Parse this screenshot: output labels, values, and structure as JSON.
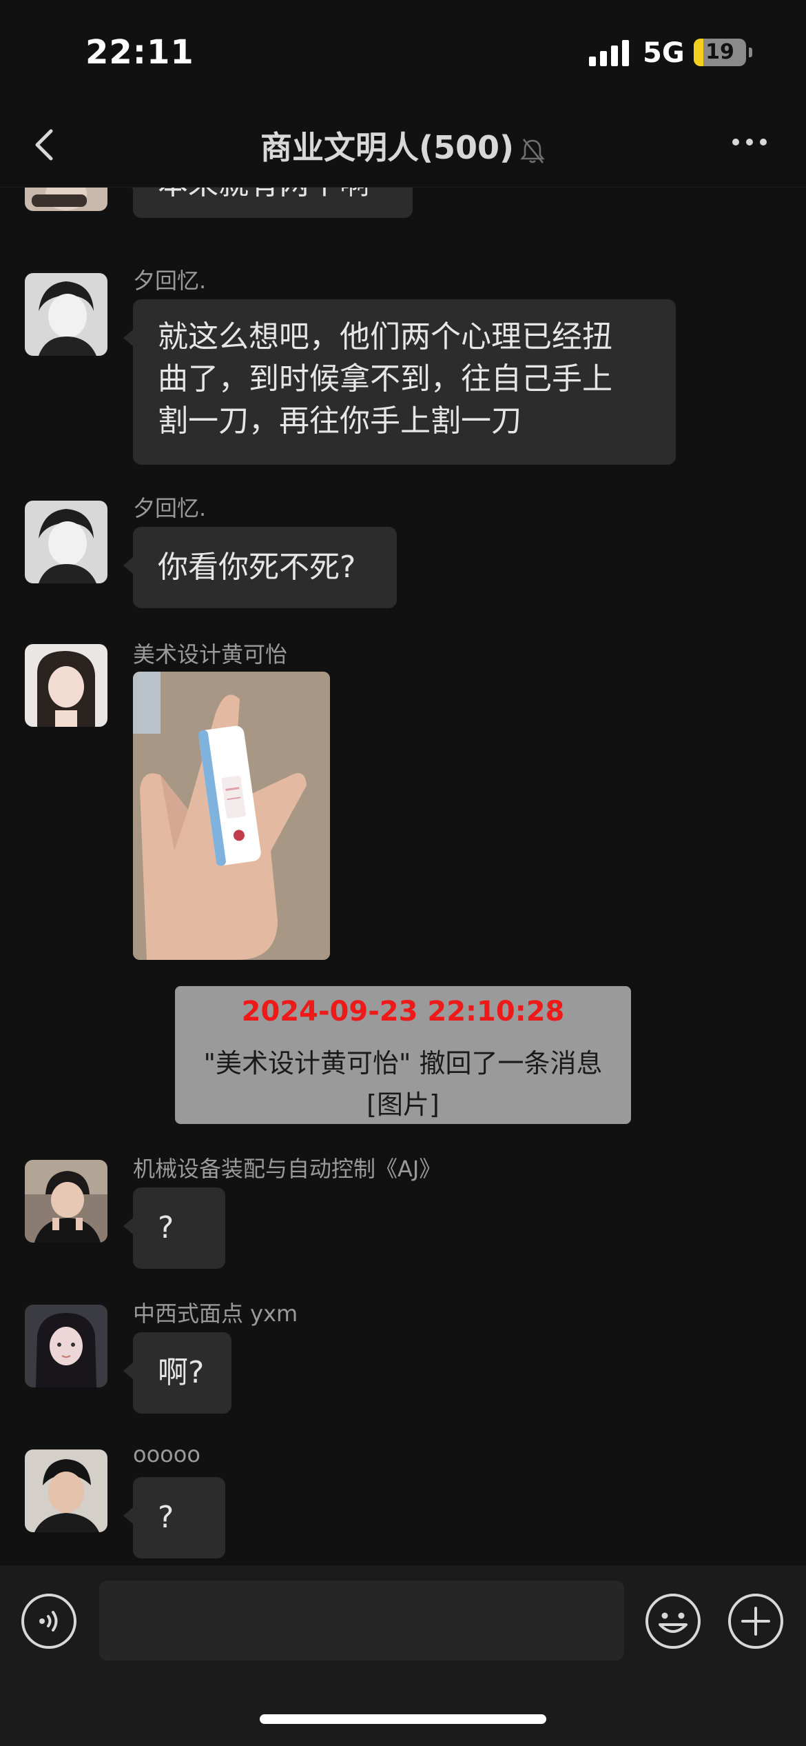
{
  "status_bar": {
    "time": "22:11",
    "network": "5G",
    "battery": "19",
    "battery_level": 0.19
  },
  "nav": {
    "title": "商业文明人(500)",
    "muted": true,
    "icons": [
      "chevron-left-icon",
      "bell-off-icon",
      "more-icon"
    ]
  },
  "messages": [
    {
      "sender": "",
      "text": "本来就有两个啊"
    },
    {
      "sender": "夕回忆.",
      "lines": [
        "就这么想吧，他们两个心理已经扭",
        "曲了，到时候拿不到，往自己手上",
        "割一刀，再往你手上割一刀"
      ]
    },
    {
      "sender": "夕回忆.",
      "text": "你看你死不死?"
    },
    {
      "sender": "美术设计黄可怡",
      "image": "photo-of-pregnancy-test-in-hand"
    },
    {
      "sender": "机械设备装配与自动控制《AJ》",
      "text": "?"
    },
    {
      "sender": "中西式面点 yxm",
      "text": "啊?"
    },
    {
      "sender": "ooooo",
      "text": "?"
    }
  ],
  "recall_notice": {
    "timestamp": "2024-09-23 22:10:28",
    "line1": "\"美术设计黄可怡\" 撤回了一条消息",
    "line2": "[图片]"
  },
  "input_bar": {
    "placeholder": "",
    "icons": [
      "voice-icon",
      "emoji-icon",
      "plus-icon"
    ]
  },
  "colors": {
    "background": "#111111",
    "bubble": "#2c2c2c",
    "recall_card": "#9a9a9a",
    "recall_timestamp": "#ee1a1a"
  }
}
